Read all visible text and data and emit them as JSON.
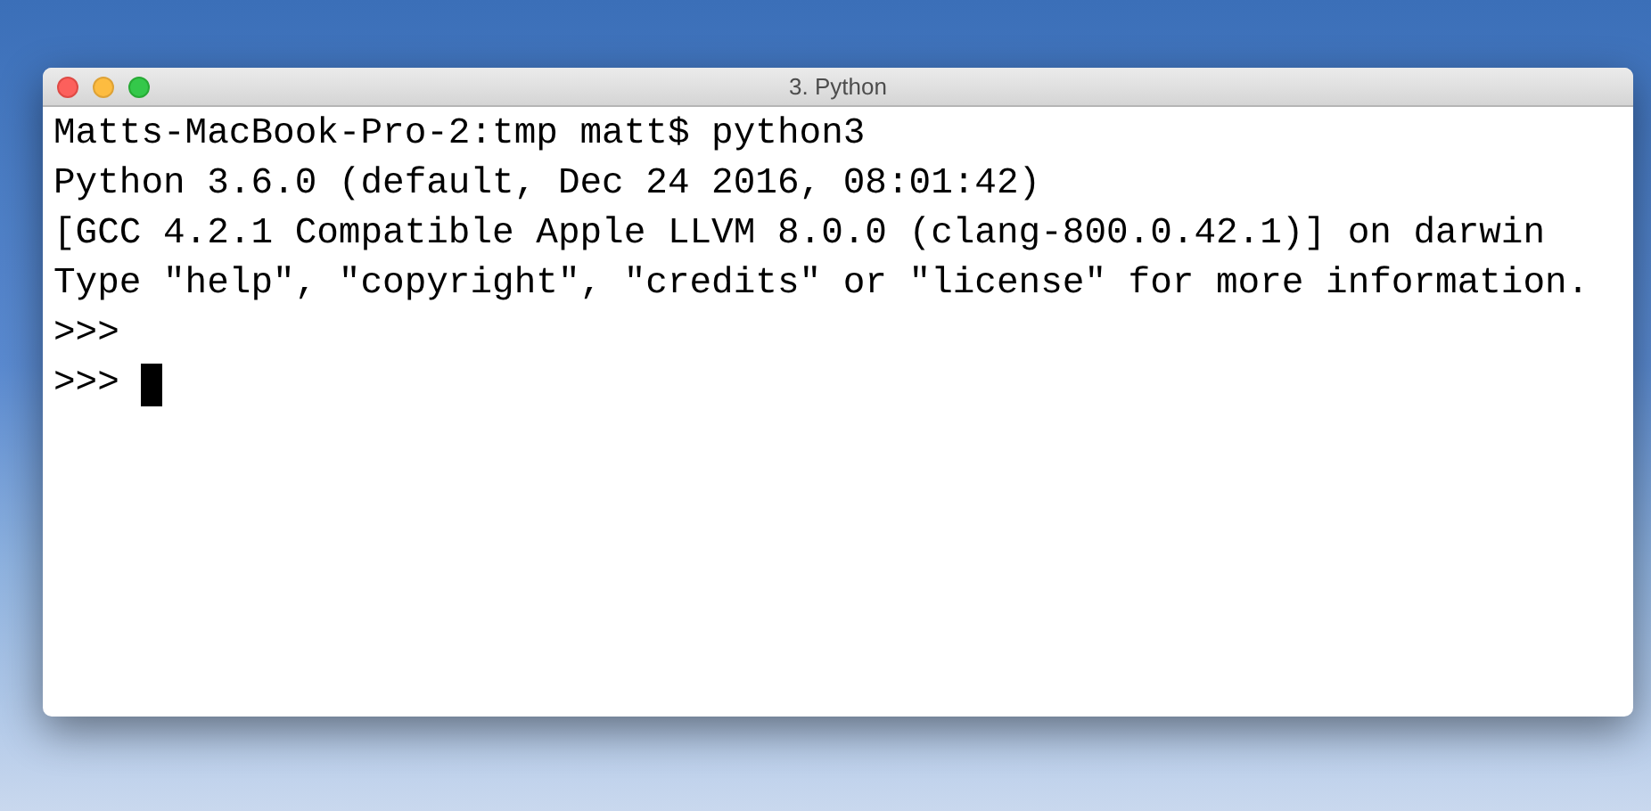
{
  "window": {
    "title": "3. Python"
  },
  "terminal": {
    "lines": [
      {
        "text": "Matts-MacBook-Pro-2:tmp matt$ python3"
      },
      {
        "text": "Python 3.6.0 (default, Dec 24 2016, 08:01:42)"
      },
      {
        "text": "[GCC 4.2.1 Compatible Apple LLVM 8.0.0 (clang-800.0.42.1)] on darwin"
      },
      {
        "text": "Type \"help\", \"copyright\", \"credits\" or \"license\" for more information."
      },
      {
        "text": ">>>"
      },
      {
        "text": ">>>"
      }
    ],
    "cursor_visible": true
  }
}
